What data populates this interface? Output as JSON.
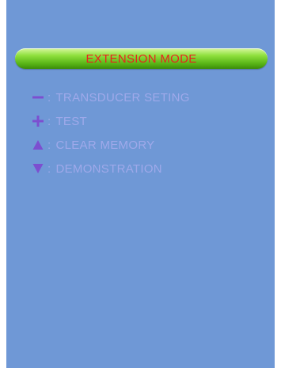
{
  "header": {
    "title": "EXTENSION MODE",
    "title_color": "#e8231e",
    "bar_color": "#6cc424"
  },
  "screen": {
    "background_color": "#6f98d6",
    "text_color": "#9fa9ea",
    "icon_color": "#7c4fd0"
  },
  "menu": {
    "items": [
      {
        "icon": "minus-icon",
        "separator": ":",
        "label": "TRANSDUCER SETING"
      },
      {
        "icon": "plus-icon",
        "separator": ":",
        "label": "TEST"
      },
      {
        "icon": "triangle-up-icon",
        "separator": ":",
        "label": "CLEAR MEMORY"
      },
      {
        "icon": "triangle-down-icon",
        "separator": ":",
        "label": "DEMONSTRATION"
      }
    ]
  }
}
